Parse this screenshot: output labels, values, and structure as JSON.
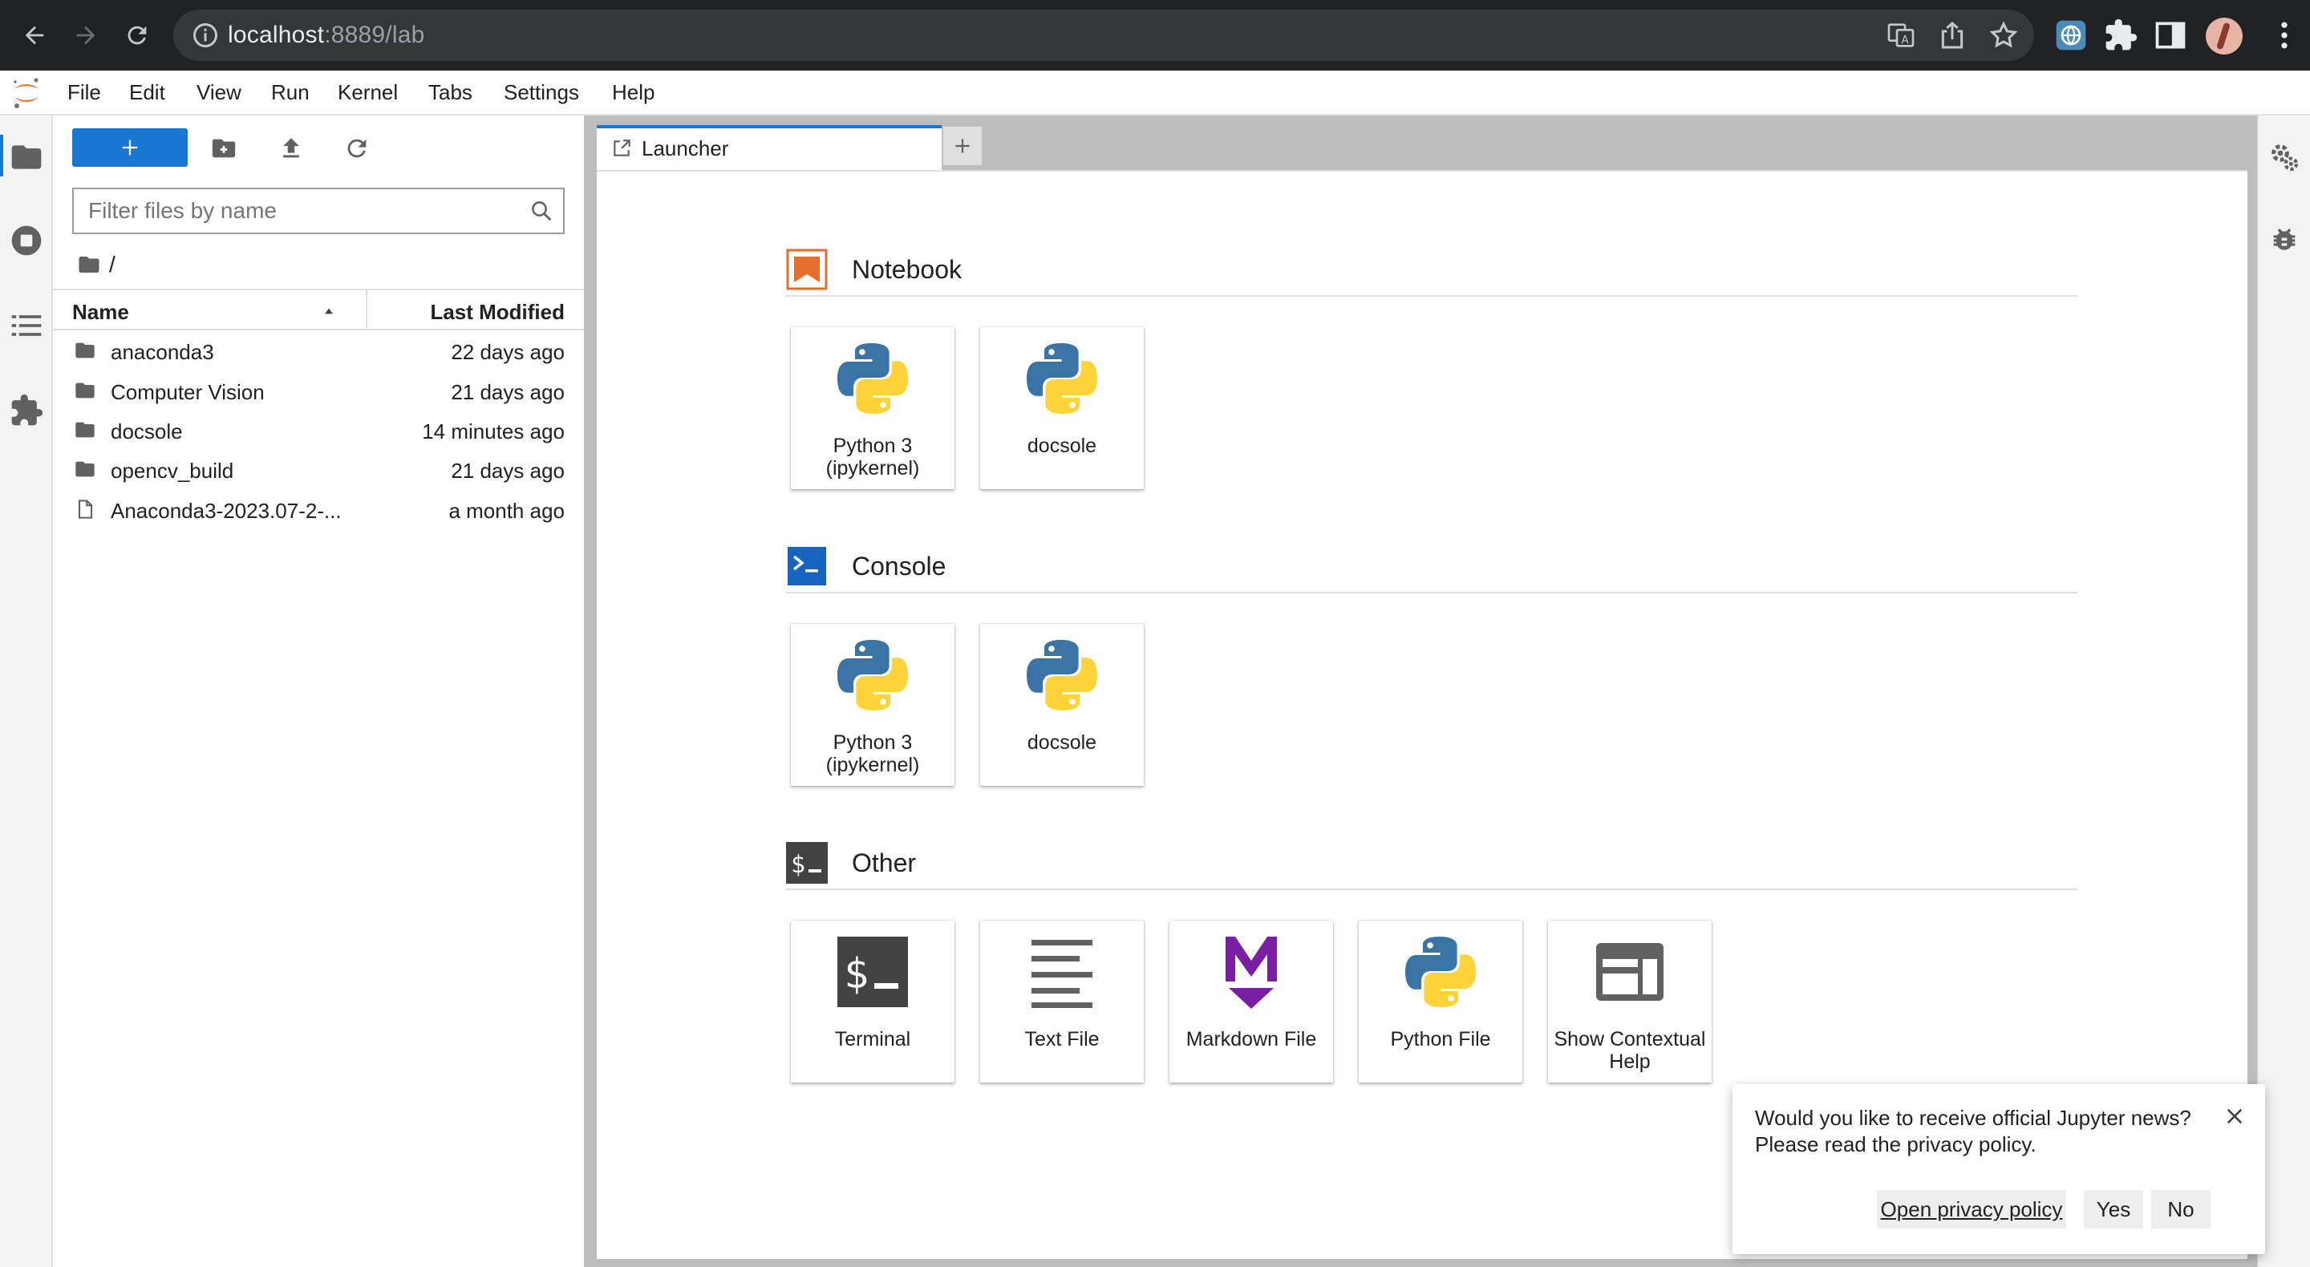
{
  "browser": {
    "url_host": "localhost",
    "url_rest": ":8889/lab"
  },
  "menubar": {
    "items": [
      "File",
      "Edit",
      "View",
      "Run",
      "Kernel",
      "Tabs",
      "Settings",
      "Help"
    ]
  },
  "filebrowser": {
    "filter_placeholder": "Filter files by name",
    "breadcrumb": "/",
    "header_name": "Name",
    "header_modified": "Last Modified",
    "files": [
      {
        "name": "anaconda3",
        "modified": "22 days ago",
        "kind": "folder"
      },
      {
        "name": "Computer Vision",
        "modified": "21 days ago",
        "kind": "folder"
      },
      {
        "name": "docsole",
        "modified": "14 minutes ago",
        "kind": "folder"
      },
      {
        "name": "opencv_build",
        "modified": "21 days ago",
        "kind": "folder"
      },
      {
        "name": "Anaconda3-2023.07-2-...",
        "modified": "a month ago",
        "kind": "file"
      }
    ]
  },
  "tabs": {
    "active_label": "Launcher"
  },
  "launcher": {
    "notebook": {
      "title": "Notebook",
      "cards": [
        {
          "label": "Python 3 (ipykernel)"
        },
        {
          "label": "docsole"
        }
      ]
    },
    "console": {
      "title": "Console",
      "cards": [
        {
          "label": "Python 3 (ipykernel)"
        },
        {
          "label": "docsole"
        }
      ]
    },
    "other": {
      "title": "Other",
      "cards": [
        {
          "label": "Terminal"
        },
        {
          "label": "Text File"
        },
        {
          "label": "Markdown File"
        },
        {
          "label": "Python File"
        },
        {
          "label": "Show Contextual Help"
        }
      ]
    }
  },
  "toast": {
    "message_line1": "Would you like to receive official Jupyter news?",
    "message_line2": "Please read the privacy policy.",
    "link_label": "Open privacy policy",
    "yes_label": "Yes",
    "no_label": "No"
  },
  "colors": {
    "accent": "#1976d2",
    "notebook_orange": "#e46e2e",
    "console_blue": "#0d47a1",
    "markdown_purple": "#7b1fa2",
    "python_blue": "#3a73a5",
    "python_yellow": "#ffd43b"
  }
}
